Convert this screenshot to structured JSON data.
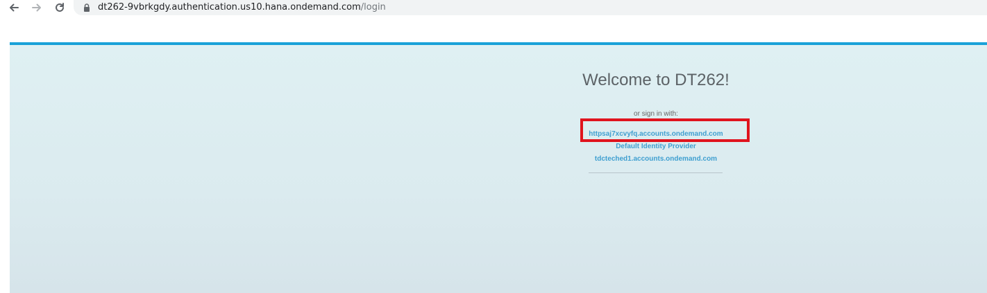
{
  "browser": {
    "back_icon": "arrow-left-icon",
    "forward_icon": "arrow-right-icon",
    "reload_icon": "reload-icon",
    "lock_icon": "lock-icon",
    "url_host": "dt262-9vbrkgdy.authentication.us10.hana.ondemand.com",
    "url_path": "/login"
  },
  "login": {
    "title": "Welcome to DT262!",
    "signin_prompt": "or sign in with:",
    "providers": [
      {
        "label": "httpsaj7xcvyfq.accounts.ondemand.com",
        "highlighted": true
      },
      {
        "label": "Default Identity Provider",
        "highlighted": false
      },
      {
        "label": "tdcteched1.accounts.ondemand.com",
        "highlighted": false
      }
    ]
  },
  "colors": {
    "accent_bar": "#1aa2d8",
    "link": "#3f9fd0",
    "highlight": "#e0141e",
    "page_bg": "#dfeef2"
  }
}
